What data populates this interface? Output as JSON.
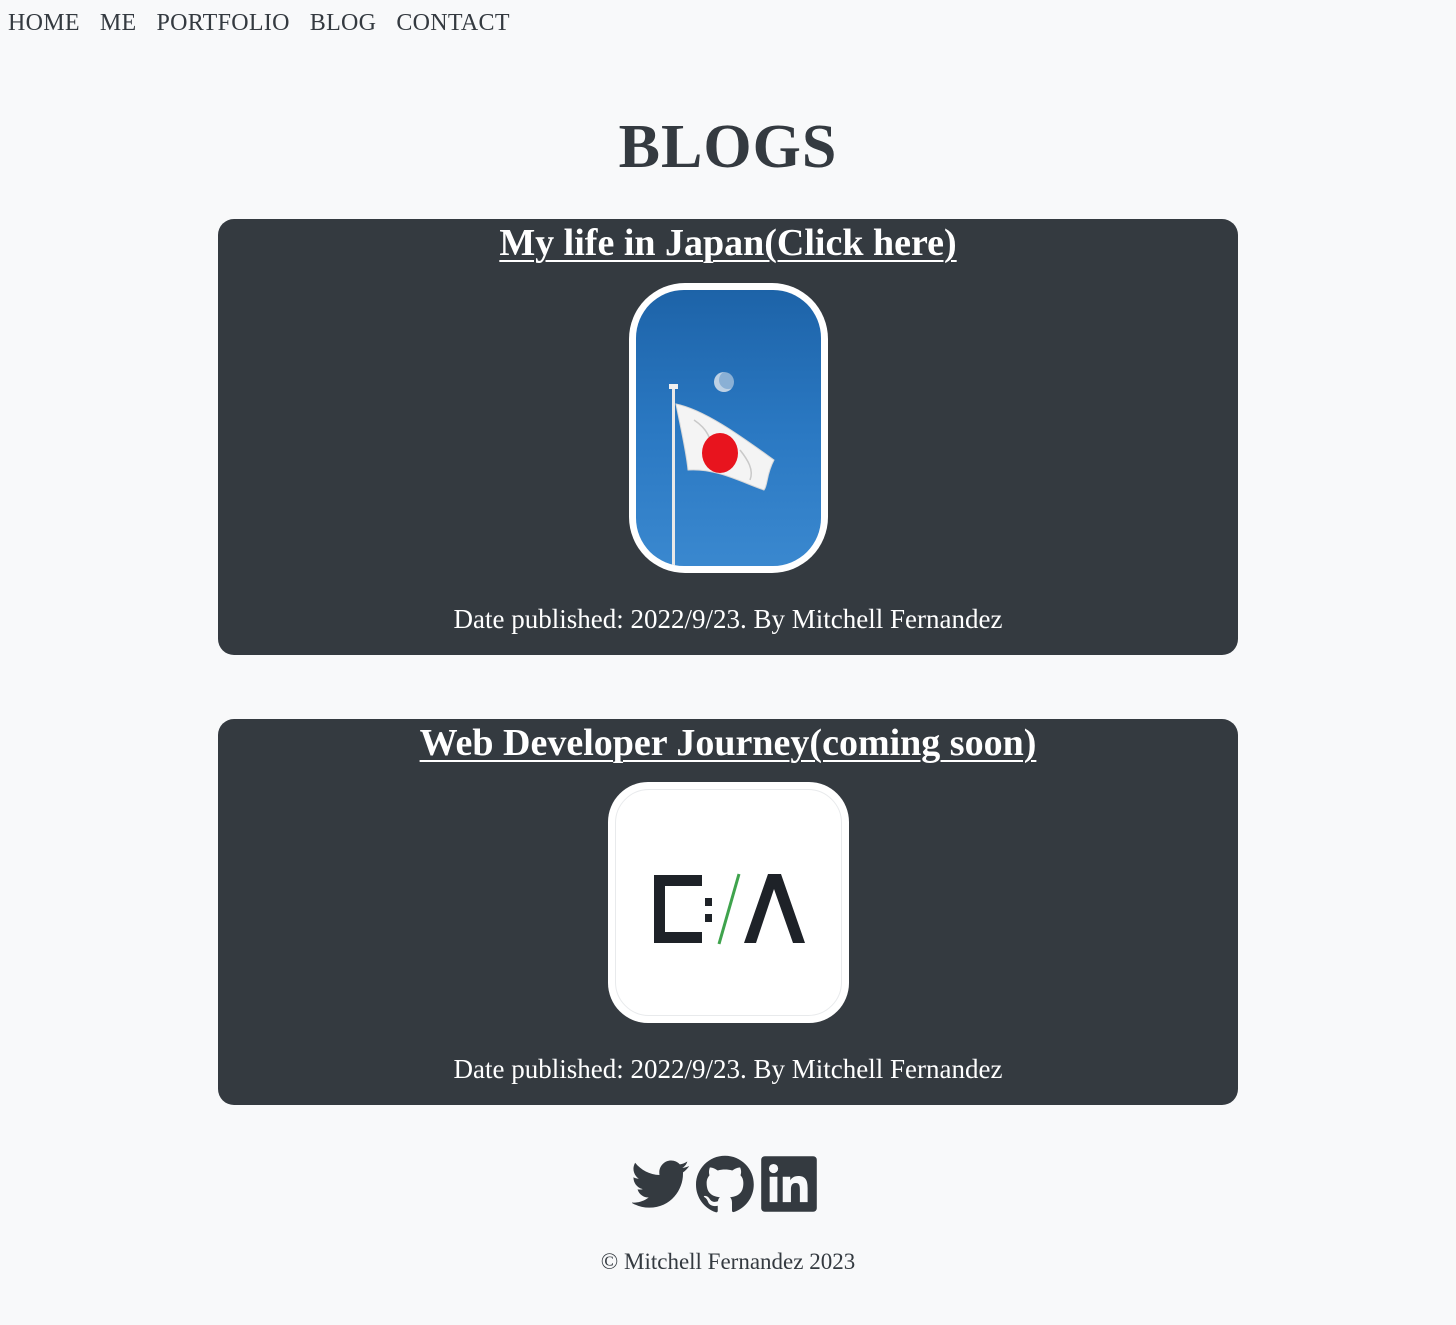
{
  "nav": {
    "items": [
      {
        "label": "HOME"
      },
      {
        "label": "ME"
      },
      {
        "label": "PORTFOLIO"
      },
      {
        "label": "BLOG"
      },
      {
        "label": "CONTACT"
      }
    ]
  },
  "page": {
    "title": "BLOGS"
  },
  "posts": [
    {
      "title": "My life in Japan(Click here)",
      "image": "japan-flag-photo",
      "meta": "Date published: 2022/9/23. By Mitchell Fernandez"
    },
    {
      "title": "Web Developer Journey(coming soon)",
      "image": "c-slash-a-logo",
      "meta": "Date published: 2022/9/23. By Mitchell Fernandez"
    }
  ],
  "socials": [
    {
      "icon": "twitter-icon"
    },
    {
      "icon": "github-icon"
    },
    {
      "icon": "linkedin-icon"
    }
  ],
  "footer": {
    "copyright": "© Mitchell Fernandez 2023"
  },
  "colors": {
    "background": "#f8f9fa",
    "card": "#343a40",
    "text": "#343a40",
    "accent_green": "#3fa34d"
  }
}
